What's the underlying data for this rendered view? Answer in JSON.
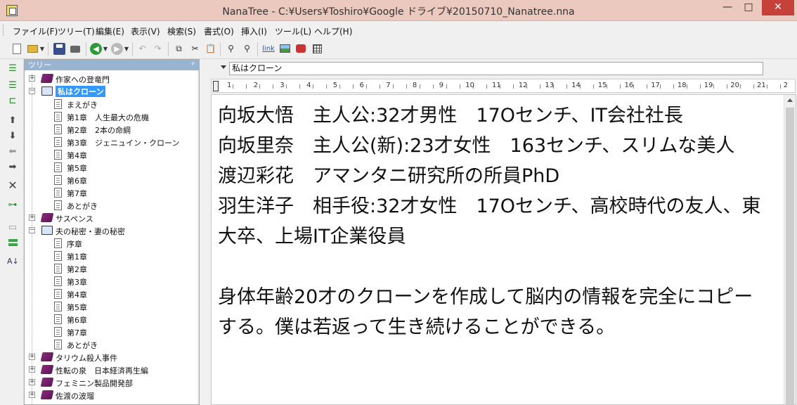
{
  "window": {
    "title": "NanaTree - C:¥Users¥Toshiro¥Google ドライブ¥20150710_Nanatree.nna",
    "minimize_glyph": "—",
    "maximize_glyph": "□",
    "close_glyph": "✕"
  },
  "menu": [
    "ファイル(F)",
    "ツリー(T)",
    "編集(E)",
    "表示(V)",
    "検索(S)",
    "書式(O)",
    "挿入(I)",
    "ツール(L)",
    "ヘルプ(H)"
  ],
  "toolbar": {
    "link_label": "link"
  },
  "tree": {
    "header": "ツリー",
    "pin_glyph": "ᵖ",
    "nodes": [
      {
        "label": "作家への登竜門",
        "level": 0,
        "type": "book-closed",
        "toggle": "+"
      },
      {
        "label": "私はクローン",
        "level": 0,
        "type": "book-open",
        "toggle": "−",
        "selected": true
      },
      {
        "label": "まえがき",
        "level": 1,
        "type": "page"
      },
      {
        "label": "第1章　人生最大の危機",
        "level": 1,
        "type": "page"
      },
      {
        "label": "第2章　2本の命綱",
        "level": 1,
        "type": "page"
      },
      {
        "label": "第3章　ジェニュイン・クローン",
        "level": 1,
        "type": "page"
      },
      {
        "label": "第4章",
        "level": 1,
        "type": "page"
      },
      {
        "label": "第5章",
        "level": 1,
        "type": "page"
      },
      {
        "label": "第6章",
        "level": 1,
        "type": "page"
      },
      {
        "label": "第7章",
        "level": 1,
        "type": "page"
      },
      {
        "label": "あとがき",
        "level": 1,
        "type": "page"
      },
      {
        "label": "サスペンス",
        "level": 0,
        "type": "book-closed",
        "toggle": "+"
      },
      {
        "label": "夫の秘密・妻の秘密",
        "level": 0,
        "type": "book-open",
        "toggle": "−"
      },
      {
        "label": "序章",
        "level": 1,
        "type": "page"
      },
      {
        "label": "第1章",
        "level": 1,
        "type": "page"
      },
      {
        "label": "第2章",
        "level": 1,
        "type": "page"
      },
      {
        "label": "第3章",
        "level": 1,
        "type": "page"
      },
      {
        "label": "第4章",
        "level": 1,
        "type": "page"
      },
      {
        "label": "第5章",
        "level": 1,
        "type": "page"
      },
      {
        "label": "第6章",
        "level": 1,
        "type": "page"
      },
      {
        "label": "第7章",
        "level": 1,
        "type": "page"
      },
      {
        "label": "あとがき",
        "level": 1,
        "type": "page"
      },
      {
        "label": "タリウム殺人事件",
        "level": 0,
        "type": "book-closed",
        "toggle": "+"
      },
      {
        "label": "性転の泉　日本経済再生編",
        "level": 0,
        "type": "book-closed",
        "toggle": "+"
      },
      {
        "label": "フェミニン製品開発部",
        "level": 0,
        "type": "book-closed",
        "toggle": "+"
      },
      {
        "label": "佐渡の波瑠",
        "level": 0,
        "type": "book-closed",
        "toggle": "+"
      }
    ]
  },
  "editor": {
    "node_title": "私はクローン",
    "ruler_numbers": [
      "1",
      "2",
      "3",
      "4",
      "5",
      "6",
      "7",
      "8",
      "9",
      "10",
      "11",
      "12",
      "13",
      "14",
      "15",
      "16",
      "17",
      "18",
      "19",
      "20",
      "21",
      "2"
    ],
    "body": "向坂大悟　主人公:32才男性　17Oセンチ、IT会社社長\n向坂里奈　主人公(新):23才女性　163センチ、スリムな美人\n渡辺彩花　アマンタニ研究所の所員PhD\n羽生洋子　相手役:32才女性　17Oセンチ、高校時代の友人、東大卒、上場IT企業役員\n\n身体年齢20才のクローンを作成して脳内の情報を完全にコピーする。僕は若返って生き続けることができる。"
  }
}
